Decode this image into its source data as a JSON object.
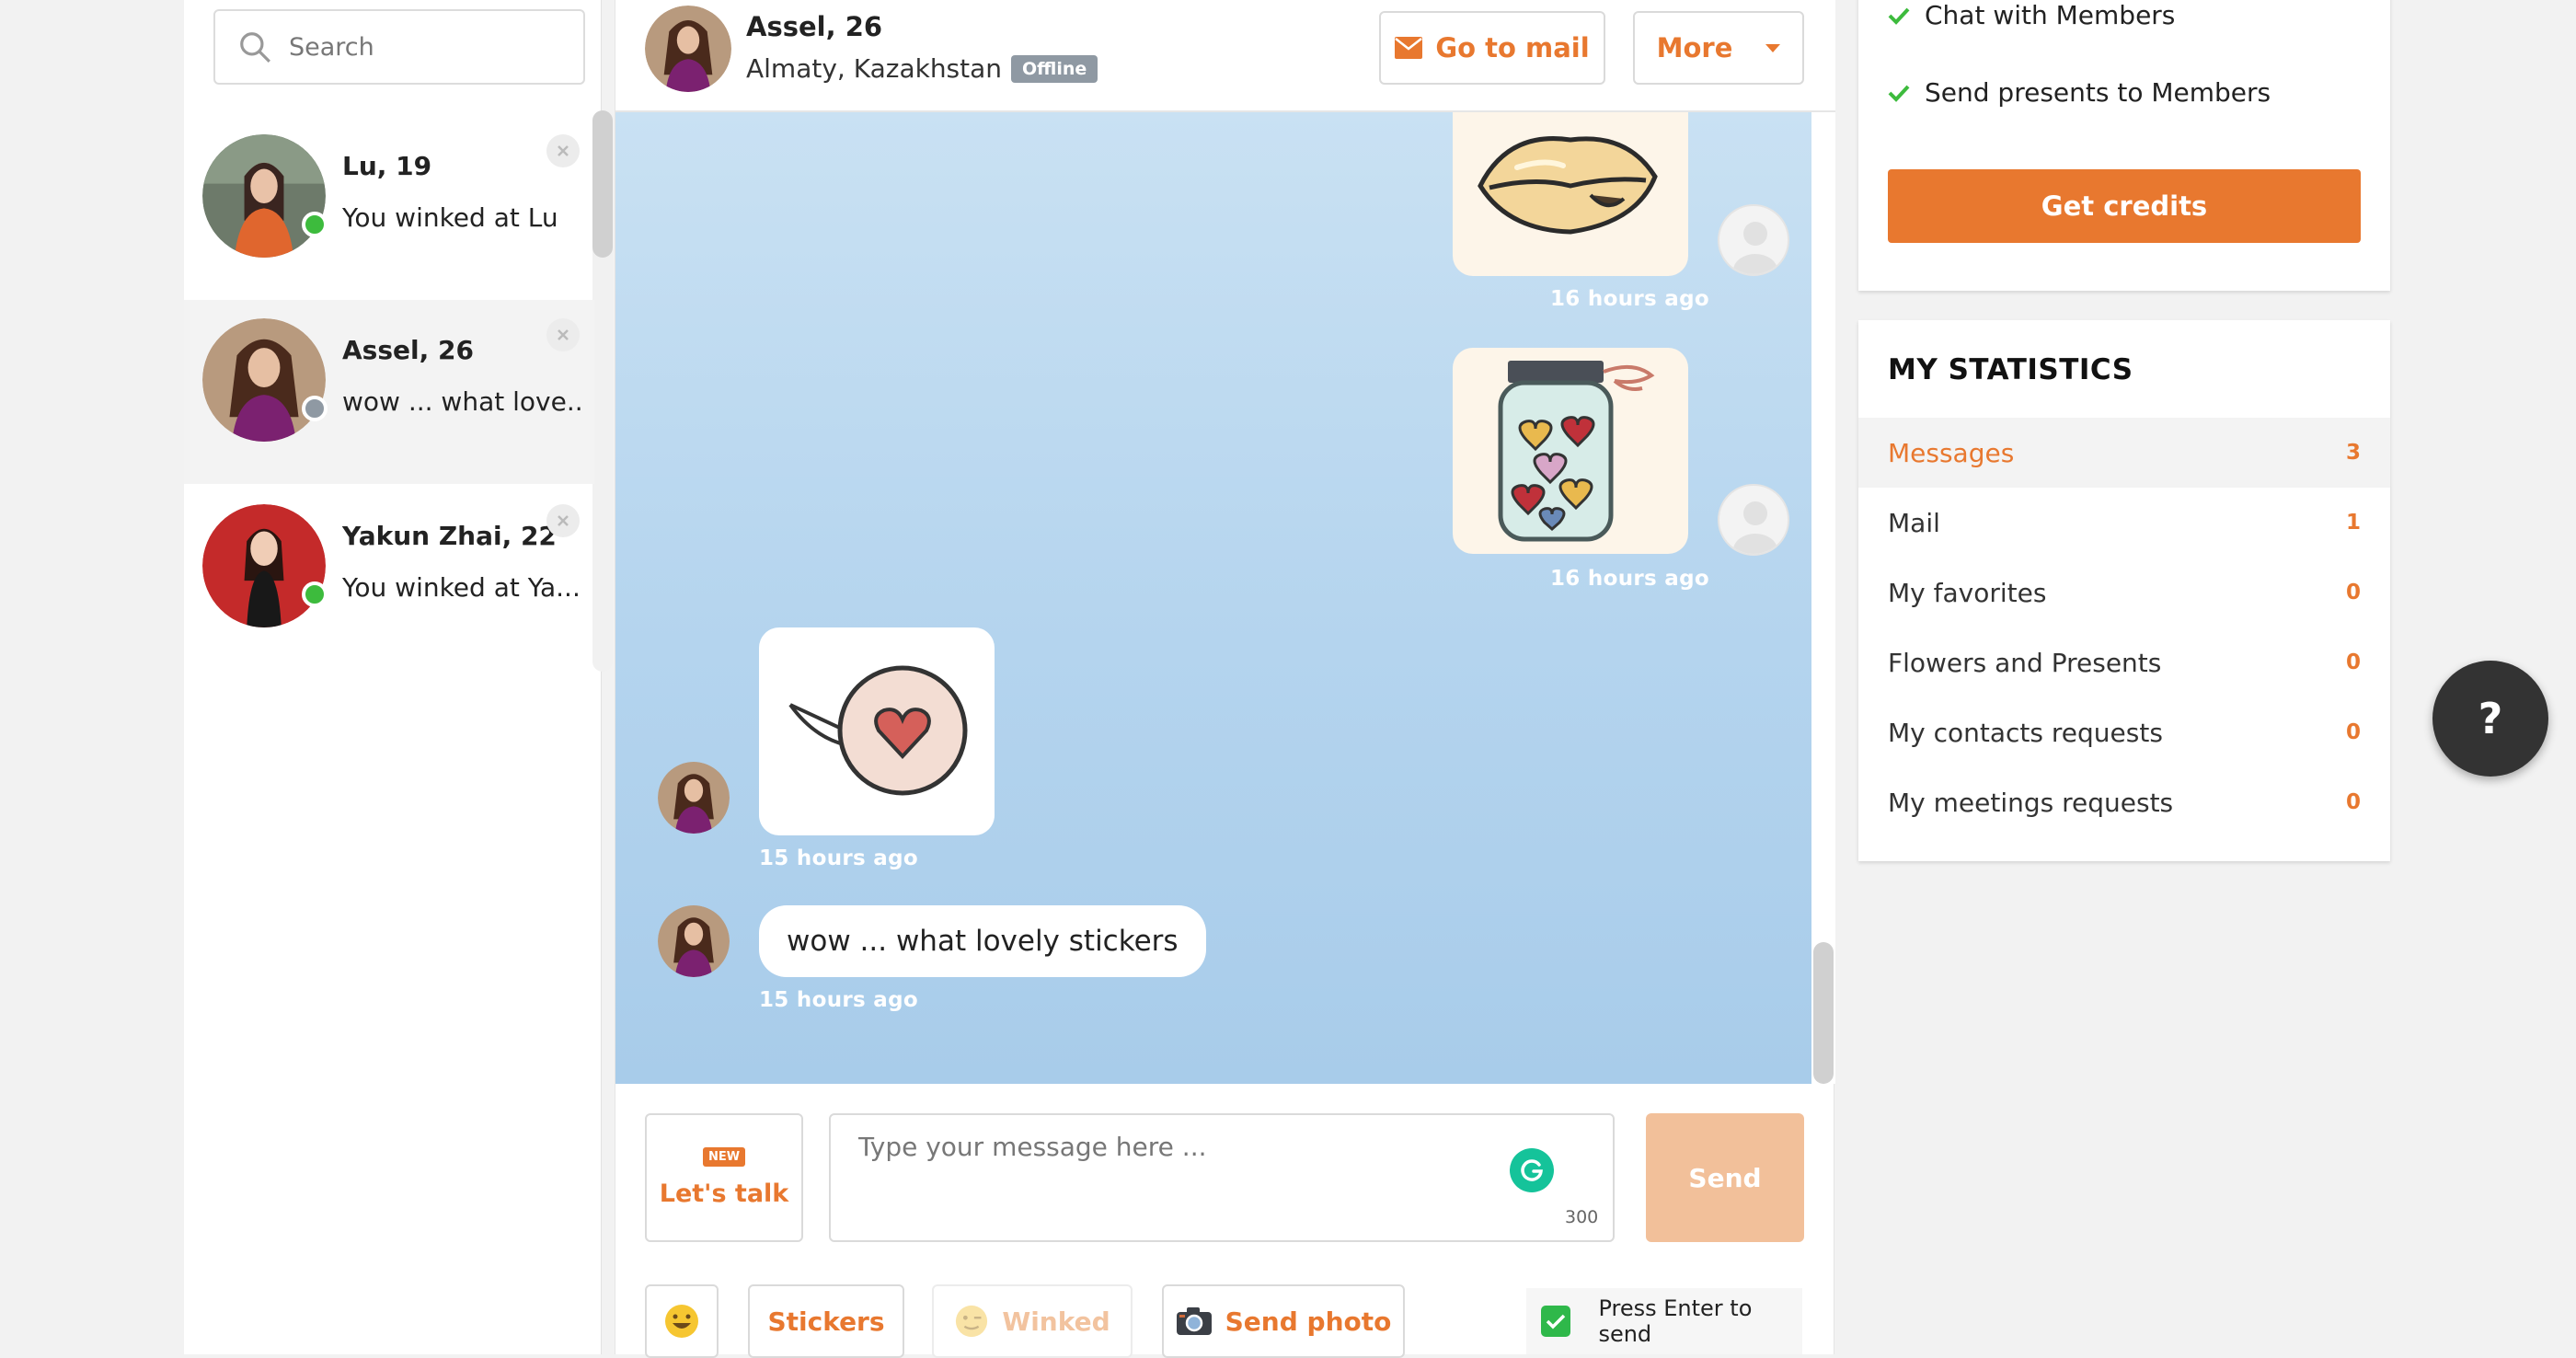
{
  "search": {
    "placeholder": "Search"
  },
  "contacts": [
    {
      "name": "Lu, 19",
      "preview": "You winked at Lu",
      "status": "online"
    },
    {
      "name": "Assel, 26",
      "preview": "wow ... what love...",
      "status": "offline"
    },
    {
      "name": "Yakun Zhai, 22",
      "preview": "You winked at Ya...",
      "status": "online"
    }
  ],
  "header": {
    "name": "Assel, 26",
    "location": "Almaty, Kazakhstan",
    "status_badge": "Offline",
    "mail_button": "Go to mail",
    "more_button": "More"
  },
  "messages": [
    {
      "type": "sticker",
      "sticker": "lips-sticker",
      "direction": "outgoing",
      "time": "16 hours ago"
    },
    {
      "type": "sticker",
      "sticker": "hearts-jar-sticker",
      "direction": "outgoing",
      "time": "16 hours ago"
    },
    {
      "type": "sticker",
      "sticker": "heart-speech-bubble-sticker",
      "direction": "incoming",
      "time": "15 hours ago"
    },
    {
      "type": "text",
      "text": "wow ... what lovely stickers",
      "direction": "incoming",
      "time": "15 hours ago"
    }
  ],
  "composer": {
    "new_badge": "NEW",
    "talk_label": "Let's talk",
    "placeholder": "Type your message here ...",
    "char_limit": "300",
    "send_label": "Send",
    "stickers_label": "Stickers",
    "winked_label": "Winked",
    "send_photo_label": "Send photo",
    "press_enter_label": "Press Enter to send"
  },
  "perks": {
    "items": [
      "Chat with Members",
      "Send presents to Members"
    ],
    "credits_button": "Get credits"
  },
  "statistics": {
    "title": "MY STATISTICS",
    "rows": [
      {
        "label": "Messages",
        "count": "3"
      },
      {
        "label": "Mail",
        "count": "1"
      },
      {
        "label": "My favorites",
        "count": "0"
      },
      {
        "label": "Flowers and Presents",
        "count": "0"
      },
      {
        "label": "My contacts requests",
        "count": "0"
      },
      {
        "label": "My meetings requests",
        "count": "0"
      }
    ]
  },
  "help": {
    "label": "?"
  },
  "colors": {
    "accent": "#e8782f",
    "online": "#3dbb3d",
    "offline": "#8f99a3",
    "chat_bg": "#b4d4ee",
    "send_disabled": "#f2c09a"
  }
}
